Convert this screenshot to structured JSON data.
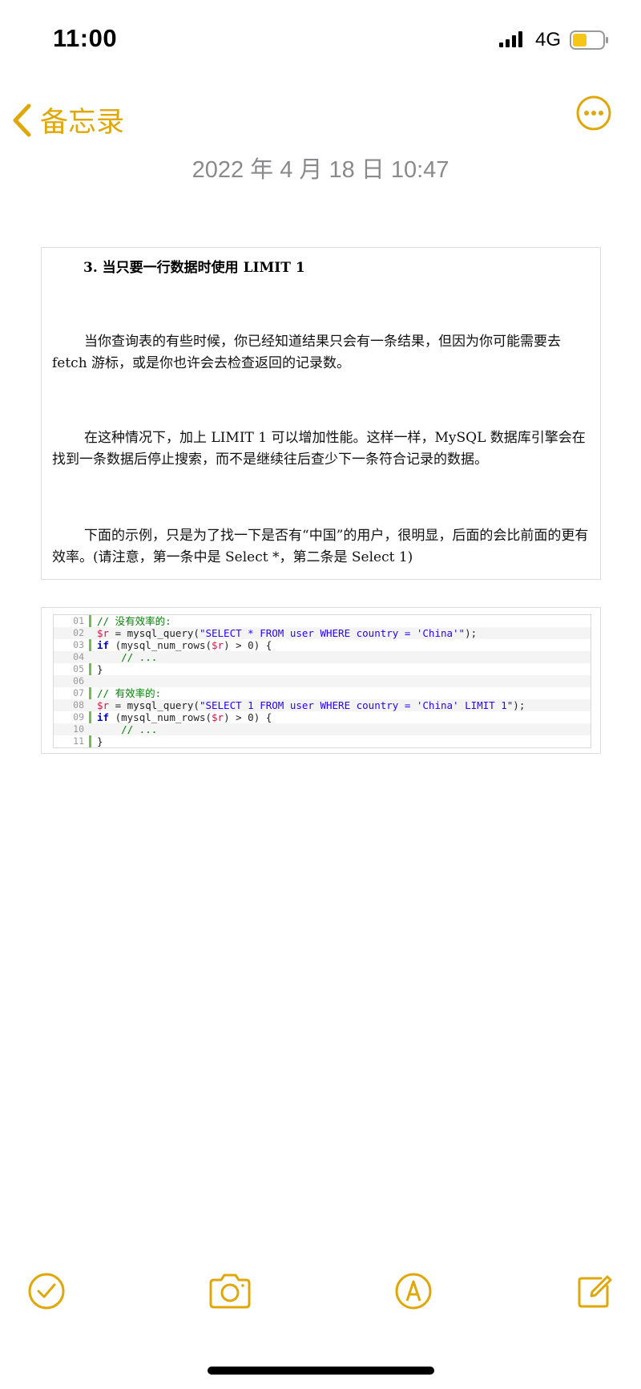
{
  "status_bar": {
    "time": "11:00",
    "network": "4G"
  },
  "nav": {
    "back_label": "备忘录",
    "back_icon": "chevron-left-icon",
    "more_icon": "ellipsis-circle-icon"
  },
  "note": {
    "date": "2022 年 4 月 18 日 10:47"
  },
  "document": {
    "heading": "3.  当只要一行数据时使用 LIMIT 1",
    "paragraphs": [
      "当你查询表的有些时候，你已经知道结果只会有一条结果，但因为你可能需要去 fetch 游标，或是你也许会去检查返回的记录数。",
      "在这种情况下，加上 LIMIT 1 可以增加性能。这样一样，MySQL 数据库引擎会在找到一条数据后停止搜索，而不是继续往后查少下一条符合记录的数据。",
      "下面的示例，只是为了找一下是否有“中国”的用户，很明显，后面的会比前面的更有效率。(请注意，第一条中是 Select *，第二条是 Select 1)"
    ]
  },
  "code": {
    "line_numbers": [
      "01",
      "02",
      "03",
      "04",
      "05",
      "06",
      "07",
      "08",
      "09",
      "10",
      "11"
    ],
    "lines": [
      "// 没有效率的:",
      "$r = mysql_query(\"SELECT * FROM user WHERE country = 'China'\");",
      "if (mysql_num_rows($r) > 0) {",
      "    // ...",
      "}",
      "",
      "// 有效率的:",
      "$r = mysql_query(\"SELECT 1 FROM user WHERE country = 'China' LIMIT 1\");",
      "if (mysql_num_rows($r) > 0) {",
      "    // ...",
      "}"
    ]
  },
  "toolbar": {
    "icons": [
      "checklist-icon",
      "camera-icon",
      "markup-icon",
      "compose-icon"
    ]
  },
  "colors": {
    "accent": "#e0a709",
    "date_gray": "#8a8a8e",
    "gutter_green": "#6cc24a"
  }
}
